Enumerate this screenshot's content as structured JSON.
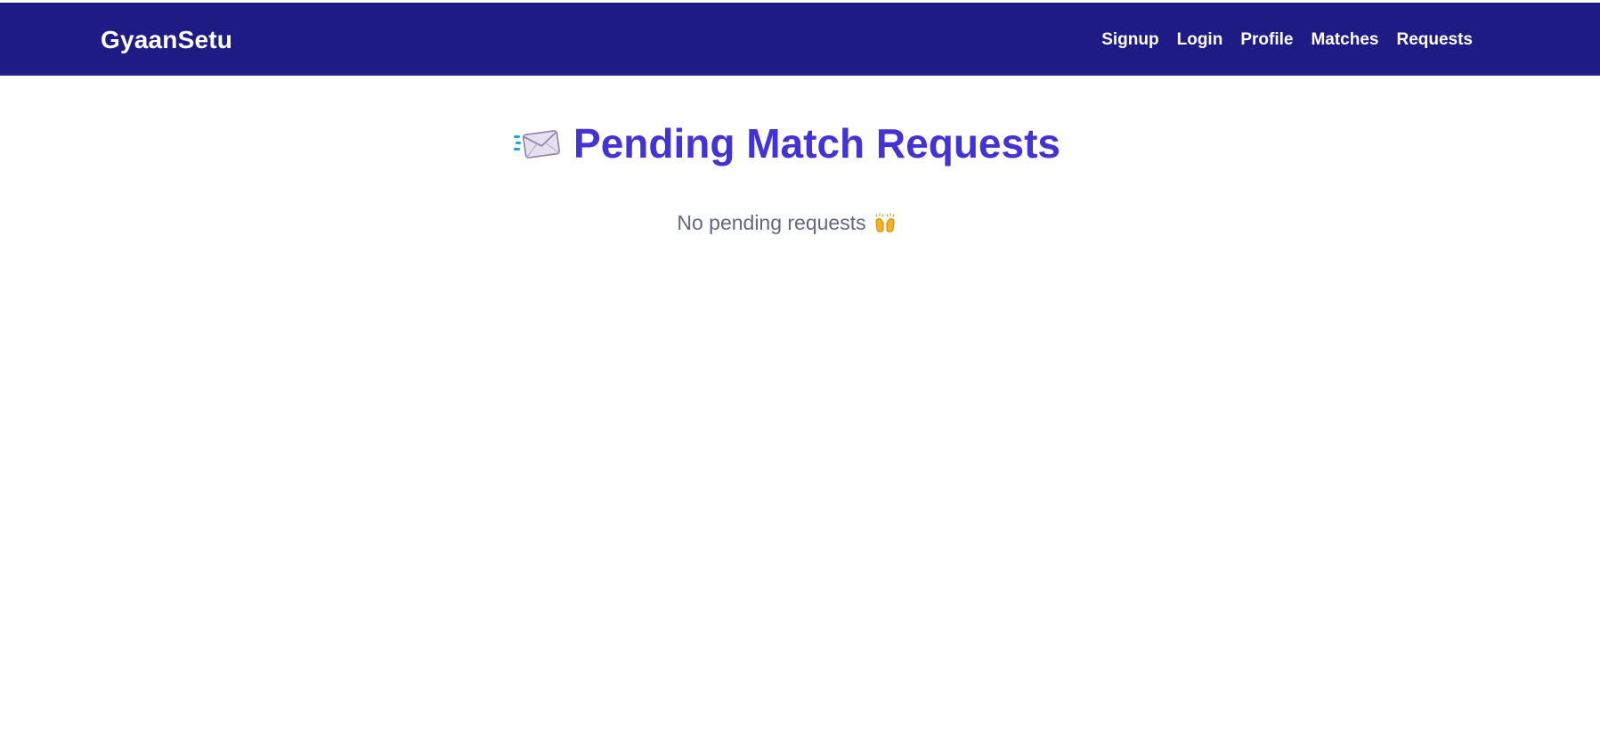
{
  "navbar": {
    "brand": "GyaanSetu",
    "links": [
      {
        "label": "Signup"
      },
      {
        "label": "Login"
      },
      {
        "label": "Profile"
      },
      {
        "label": "Matches"
      },
      {
        "label": "Requests"
      }
    ],
    "background_color": "#1f1b84"
  },
  "main": {
    "title_icon": "incoming-envelope-icon",
    "title": "Pending Match Requests",
    "title_color": "#4332d4",
    "empty_message": "No pending requests",
    "empty_icon": "raising-hands-icon"
  }
}
